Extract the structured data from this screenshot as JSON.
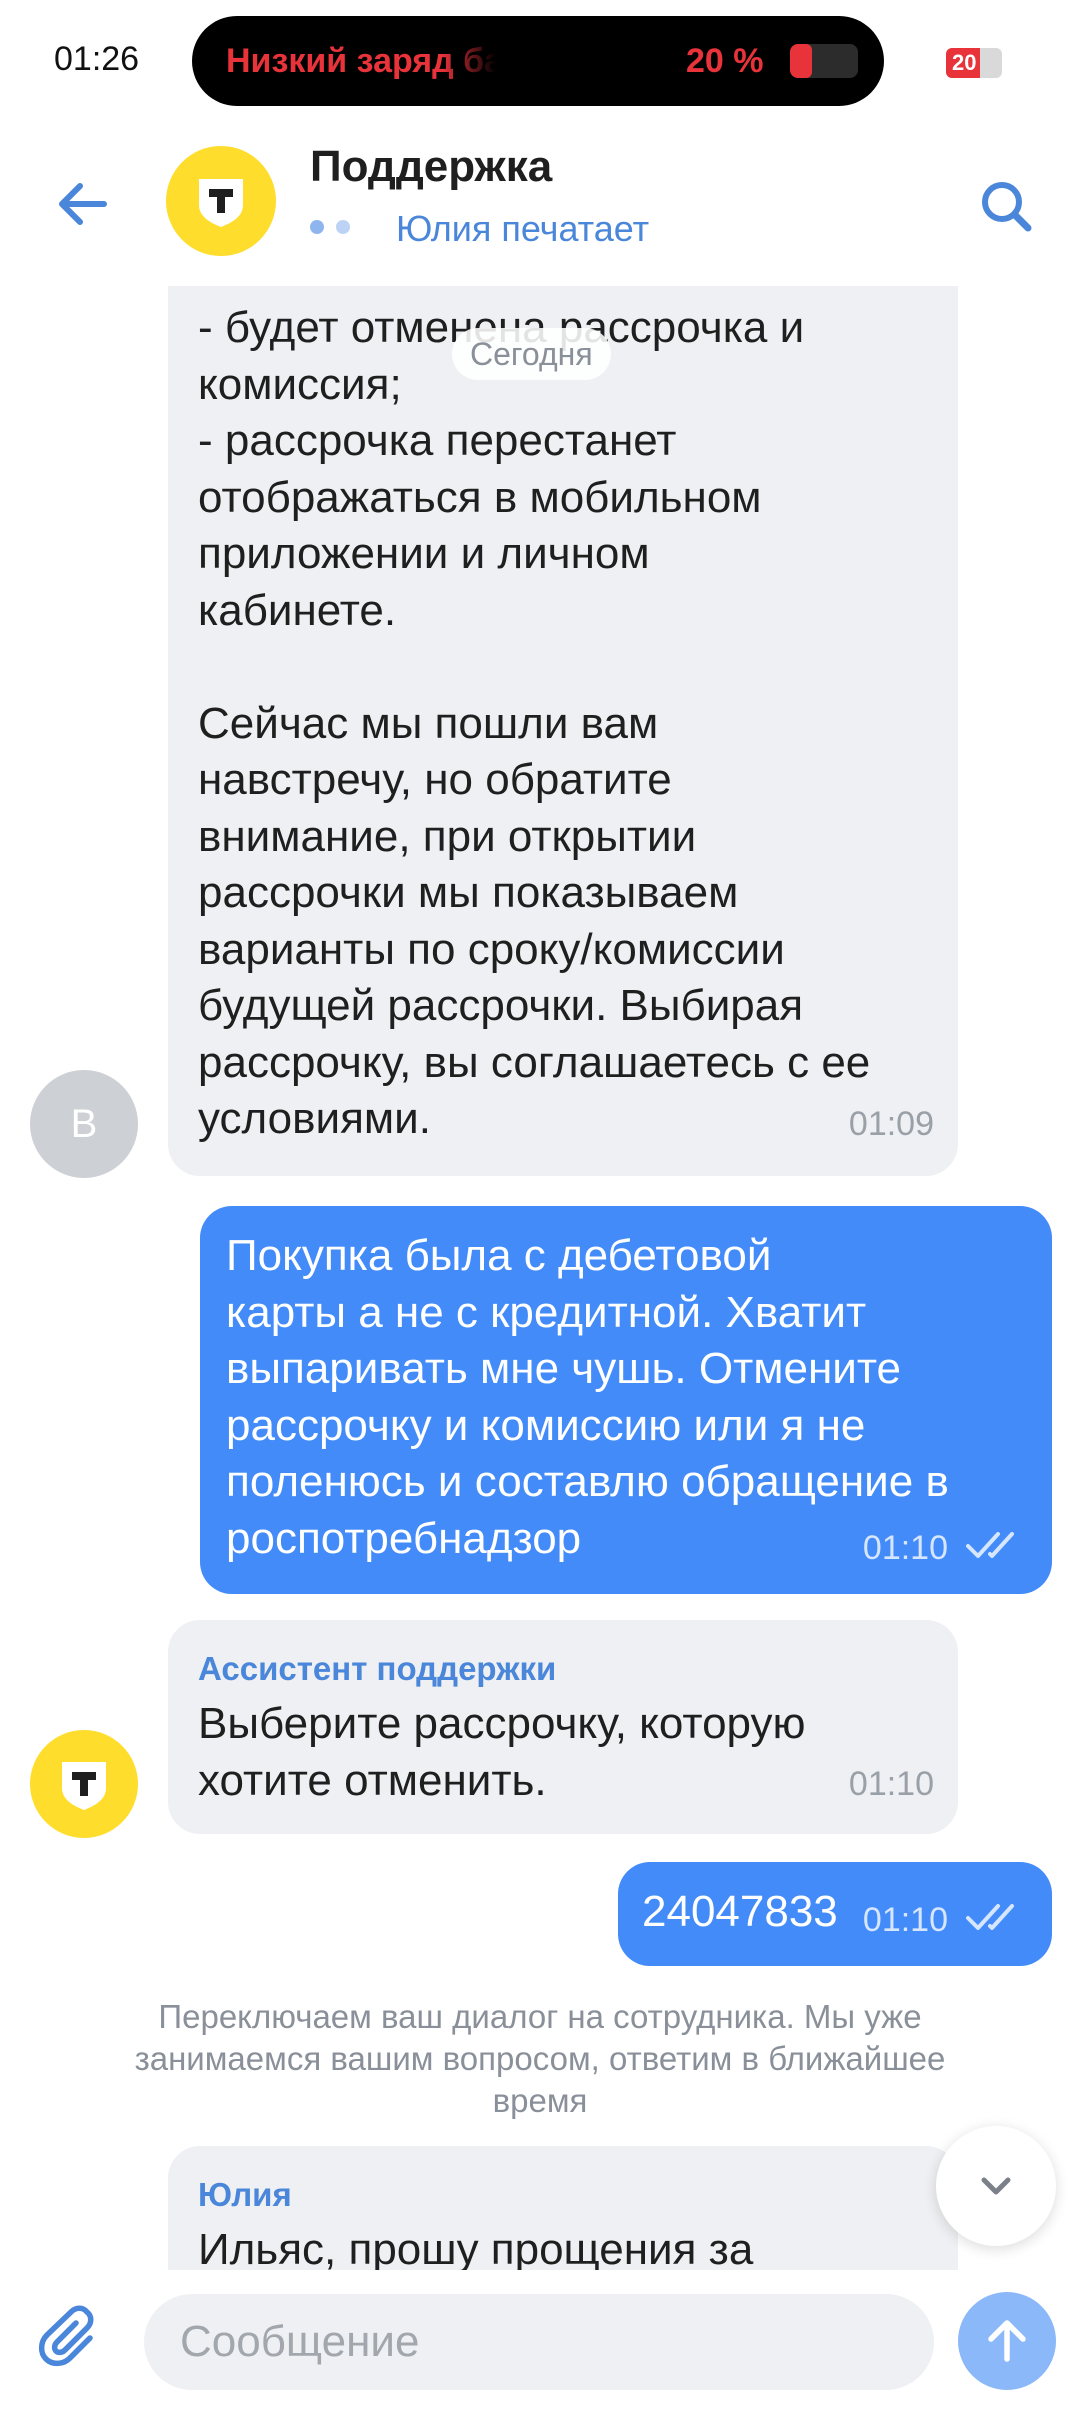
{
  "status_bar": {
    "time": "01:26",
    "island_text": "Низкий заряд батареи",
    "island_percent": "20 %",
    "battery_level": "20",
    "battery_fraction": 0.2,
    "alert_color": "#e8333a"
  },
  "header": {
    "title": "Поддержка",
    "status": "Юлия печатает",
    "back_icon": "arrow-left-icon",
    "search_icon": "search-icon",
    "avatar_icon": "bank-logo-icon"
  },
  "date_chip": "Сегодня",
  "messages": [
    {
      "direction": "in",
      "avatar_letter": "В",
      "text": "- будет отменена рассрочка и\nкомиссия;\n- рассрочка перестанет\nотображаться в мобильном\nприложении и личном\nкабинете.\n\nСейчас мы пошли вам\nнавстречу, но обратите\nвнимание, при открытии\nрассрочки мы показываем\nварианты по сроку/комиссии\nбудущей рассрочки. Выбирая\nрассрочку, вы соглашаетесь с ее\nусловиями.",
      "time": "01:09"
    },
    {
      "direction": "out",
      "text": "Покупка была с дебетовой\nкарты а не с кредитной. Хватит\nвыпаривать мне чушь. Отмените\nрассрочку и комиссию или я не\nполенюсь и составлю обращение в\nроспотребнадзор",
      "time": "01:10",
      "status": "read"
    },
    {
      "direction": "in",
      "sender": "Ассистент поддержки",
      "text": "Выберите рассрочку, которую\nхотите отменить.",
      "time": "01:10"
    },
    {
      "direction": "out",
      "text": "24047833",
      "time": "01:10",
      "status": "read"
    },
    {
      "direction": "system",
      "text": "Переключаем ваш диалог на сотрудника. Мы уже занимаемся вашим вопросом, ответим в ближайшее время"
    },
    {
      "direction": "in",
      "sender": "Юлия",
      "text": "Ильяс, прошу прощения за"
    }
  ],
  "composer": {
    "placeholder": "Сообщение",
    "attach_icon": "paperclip-icon",
    "send_icon": "arrow-up-icon",
    "scroll_icon": "chevron-down-icon"
  },
  "colors": {
    "accent": "#428bf9",
    "incoming_bubble": "#eff0f3",
    "brand_yellow": "#ffdd2d",
    "send_button": "#8ab8f8"
  }
}
